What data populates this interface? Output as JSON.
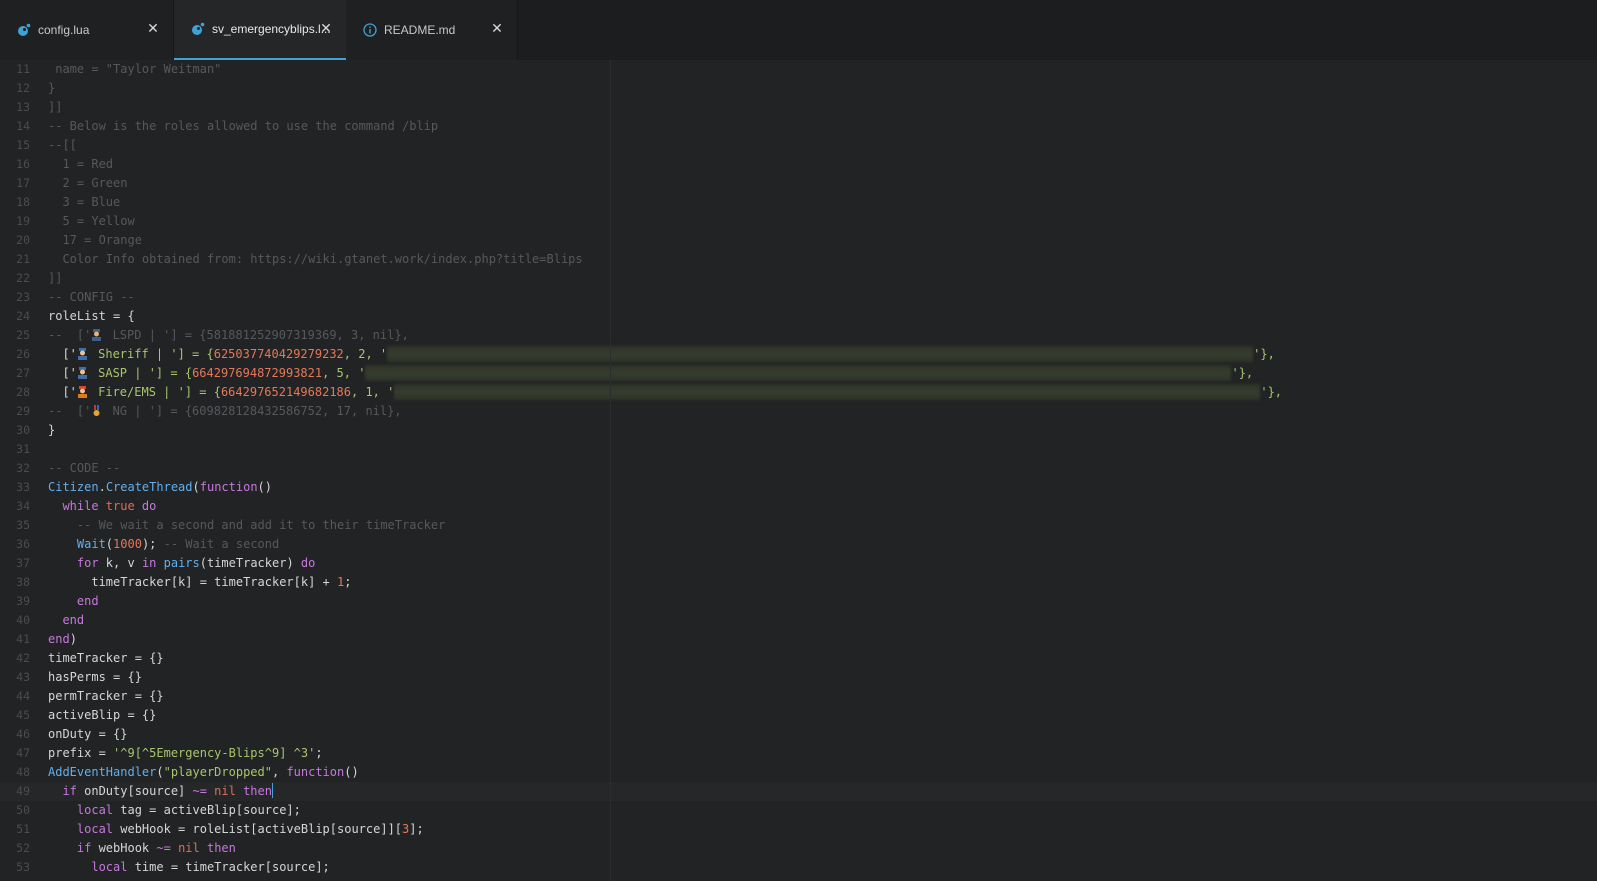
{
  "tabs": [
    {
      "label": "config.lua",
      "icon": "lua-file-icon",
      "close": "✕",
      "active": false
    },
    {
      "label": "sv_emergencyblips.l...",
      "icon": "lua-file-icon",
      "close": "✕",
      "active": true
    },
    {
      "label": "README.md",
      "icon": "info-icon",
      "close": "✕",
      "active": false
    }
  ],
  "colors": {
    "accent": "#3fa2d6",
    "background": "#222324"
  },
  "lines": [
    {
      "n": "11",
      "text": " name = \"Taylor Weitman\""
    },
    {
      "n": "12",
      "text": "}"
    },
    {
      "n": "13",
      "text": "]]"
    },
    {
      "n": "14",
      "text": "-- Below is the roles allowed to use the command /blip"
    },
    {
      "n": "15",
      "text": "--[["
    },
    {
      "n": "16",
      "text": "  1 = Red"
    },
    {
      "n": "17",
      "text": "  2 = Green"
    },
    {
      "n": "18",
      "text": "  3 = Blue"
    },
    {
      "n": "19",
      "text": "  5 = Yellow"
    },
    {
      "n": "20",
      "text": "  17 = Orange"
    },
    {
      "n": "21",
      "text": "  Color Info obtained from: https://wiki.gtanet.work/index.php?title=Blips"
    },
    {
      "n": "22",
      "text": "]]"
    },
    {
      "n": "23",
      "text": "-- CONFIG --"
    },
    {
      "n": "24",
      "text": "roleList = {"
    },
    {
      "n": "25",
      "a": "--  ['",
      "b": " LSPD | '] = {581881252907319369, 3, nil},"
    },
    {
      "n": "26",
      "a": "  ['",
      "b": " Sheriff | '] = {",
      "num": "625037740429279232",
      "c": ", 2, '",
      "d": "'},"
    },
    {
      "n": "27",
      "a": "  ['",
      "b": " SASP | '] = {",
      "num": "664297694872993821",
      "c": ", 5, '",
      "d": "'},"
    },
    {
      "n": "28",
      "a": "  ['",
      "b": " Fire/EMS | '] = {",
      "num": "664297652149682186",
      "c": ", 1, '",
      "d": "'},"
    },
    {
      "n": "29",
      "a": "--  ['",
      "b": " NG | '] = {609828128432586752, 17, nil},"
    },
    {
      "n": "30",
      "text": "}"
    },
    {
      "n": "31",
      "text": ""
    },
    {
      "n": "32",
      "text": "-- CODE --"
    },
    {
      "n": "33",
      "a": "Citizen",
      "b": ".",
      "c": "CreateThread",
      "d": "(",
      "e": "function",
      "f": "()"
    },
    {
      "n": "34",
      "a": "  while ",
      "b": "true",
      "c": " do"
    },
    {
      "n": "35",
      "text": "    -- We wait a second and add it to their timeTracker"
    },
    {
      "n": "36",
      "a": "    Wait",
      "b": "(",
      "c": "1000",
      "d": "); ",
      "e": "-- Wait a second"
    },
    {
      "n": "37",
      "a": "    for",
      "b": " k, v ",
      "c": "in",
      "d": " pairs",
      "e": "(timeTracker) ",
      "f": "do"
    },
    {
      "n": "38",
      "a": "      timeTracker[k] = timeTracker[k] + ",
      "b": "1",
      "c": ";"
    },
    {
      "n": "39",
      "text": "    end"
    },
    {
      "n": "40",
      "text": "  end"
    },
    {
      "n": "41",
      "a": "end",
      "b": ")"
    },
    {
      "n": "42",
      "text": "timeTracker = {}"
    },
    {
      "n": "43",
      "text": "hasPerms = {}"
    },
    {
      "n": "44",
      "text": "permTracker = {}"
    },
    {
      "n": "45",
      "text": "activeBlip = {}"
    },
    {
      "n": "46",
      "text": "onDuty = {}"
    },
    {
      "n": "47",
      "a": "prefix = ",
      "b": "'^9[^5Emergency-Blips^9] ^3'",
      "c": ";"
    },
    {
      "n": "48",
      "a": "AddEventHandler",
      "b": "(",
      "c": "\"playerDropped\"",
      "d": ", ",
      "e": "function",
      "f": "()"
    },
    {
      "n": "49",
      "a": "  if",
      "b": " onDuty[source] ",
      "c": "~=",
      "d": " nil",
      "e": " then"
    },
    {
      "n": "50",
      "a": "    local",
      "b": " tag = activeBlip[source];"
    },
    {
      "n": "51",
      "a": "    local",
      "b": " webHook = roleList[activeBlip[source]][",
      "c": "3",
      "d": "];"
    },
    {
      "n": "52",
      "a": "    if",
      "b": " webHook ",
      "c": "~=",
      "d": " nil",
      "e": " then"
    },
    {
      "n": "53",
      "a": "      local",
      "b": " time = timeTracker[source];"
    }
  ]
}
